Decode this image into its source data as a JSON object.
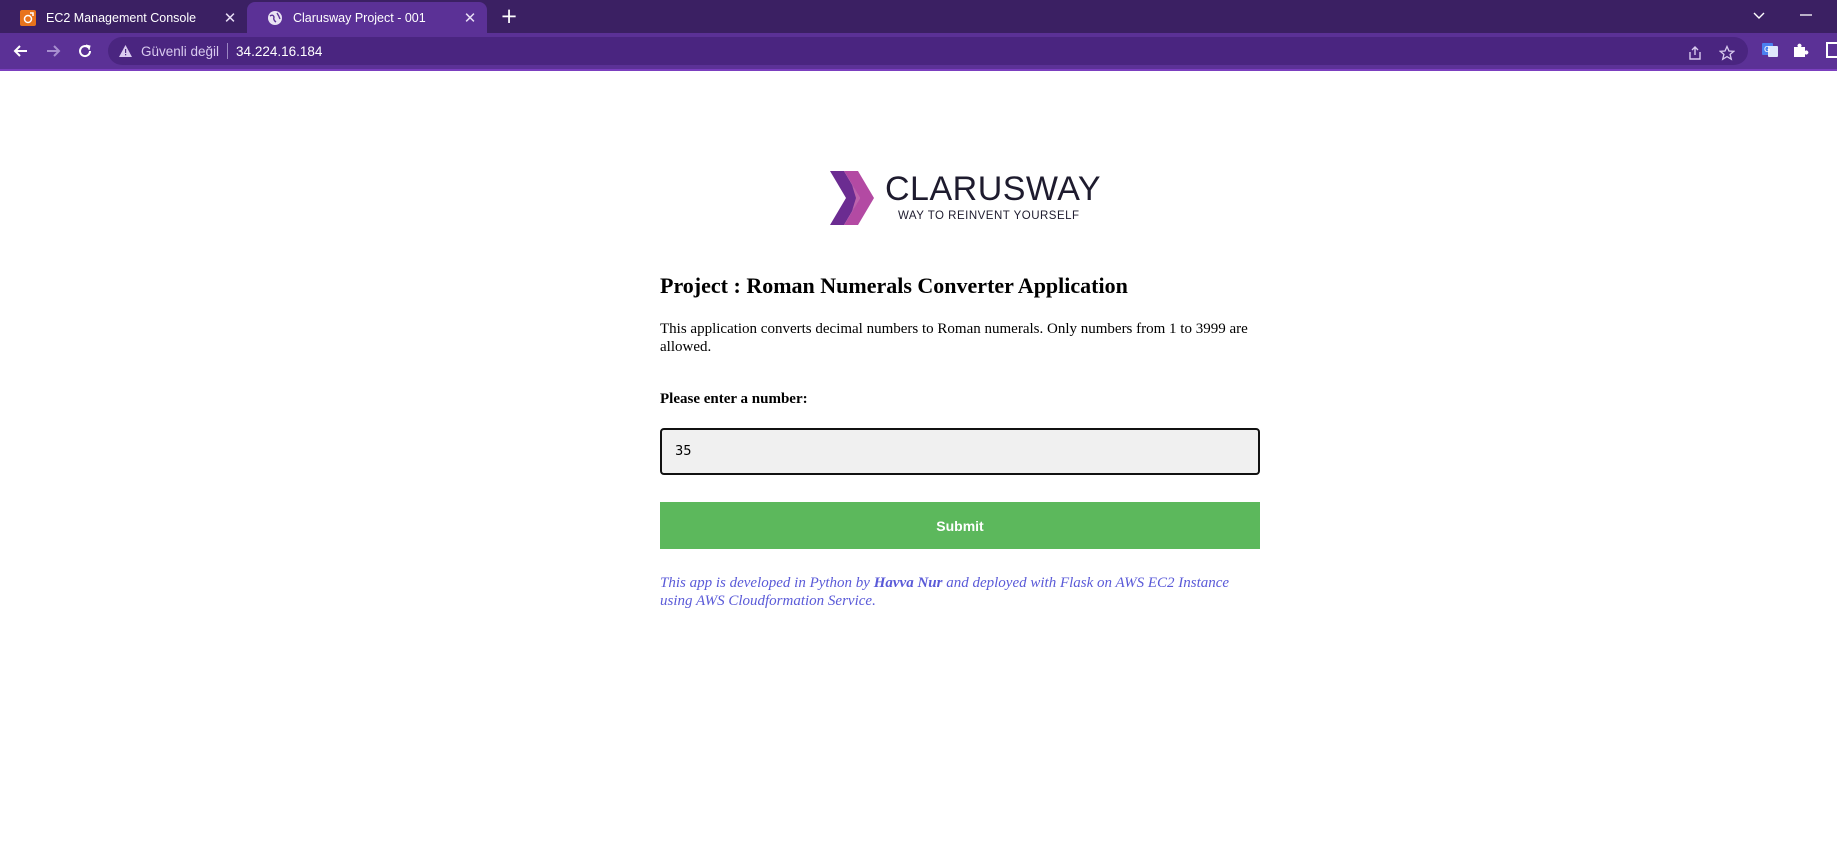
{
  "browser": {
    "tabs": [
      {
        "title": "EC2 Management Console",
        "icon": "aws-icon",
        "active": false
      },
      {
        "title": "Clarusway Project - 001",
        "icon": "globe-icon",
        "active": true
      }
    ],
    "address_bar": {
      "security_label": "Güvenli değil",
      "url": "34.224.16.184"
    },
    "colors": {
      "tabbar": "#3b2063",
      "toolbar": "#5b3196"
    }
  },
  "page": {
    "logo": {
      "name": "CLARUSWAY",
      "tagline": "WAY TO REINVENT YOURSELF"
    },
    "title": "Project : Roman Numerals Converter Application",
    "description": "This application converts decimal numbers to Roman numerals. Only numbers from 1 to 3999 are allowed.",
    "form": {
      "label": "Please enter a number:",
      "input_value": "35",
      "submit_label": "Submit"
    },
    "footer": {
      "prefix": "This app is developed in Python by ",
      "author": "Havva Nur",
      "suffix": " and deployed with Flask on AWS EC2 Instance using AWS Cloudformation Service."
    },
    "colors": {
      "submit": "#5cb85c",
      "footer_text": "#5a5ad8"
    }
  }
}
